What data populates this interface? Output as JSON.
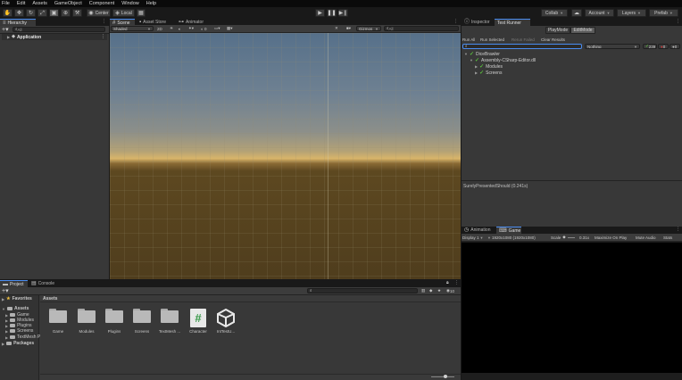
{
  "menu": [
    "File",
    "Edit",
    "Assets",
    "GameObject",
    "Component",
    "Window",
    "Help"
  ],
  "toolbar": {
    "pivot_center": "Center",
    "pivot_local": "Local",
    "collab": "Collab",
    "account": "Account",
    "layers": "Layers",
    "layout": "Prefab"
  },
  "hierarchy": {
    "tab": "Hierarchy",
    "search_placeholder": "All",
    "scene_root": "Application"
  },
  "scene_tabs": [
    "Scene",
    "Asset Store",
    "Animator"
  ],
  "scene_toolbar": {
    "shading": "Shaded",
    "mode": "2D",
    "gizmos": "Gizmos",
    "search_placeholder": "All"
  },
  "inspector": {
    "tabs": [
      "Inspector",
      "Test Runner"
    ],
    "modes": [
      "PlayMode",
      "EditMode"
    ],
    "actions": [
      "Run All",
      "Run Selected",
      "Rerun Failed",
      "Clear Results"
    ],
    "filter_value": "Nothing",
    "counts": {
      "passed": "239",
      "failed": "0",
      "skipped": "0"
    },
    "tree": [
      {
        "label": "DiceBrawler",
        "level": 0
      },
      {
        "label": "Assembly-CSharp-Editor.dll",
        "level": 1
      },
      {
        "label": "Modules",
        "level": 2
      },
      {
        "label": "Screens",
        "level": 2
      }
    ],
    "result_text": "SurelyPresentedShould (0.241s)"
  },
  "game": {
    "tabs": [
      "Animation",
      "Game"
    ],
    "display": "Display 1",
    "resolution": "1920x1080 (1920x1080)",
    "scale_label": "Scale",
    "scale_value": "0.31x",
    "maximize": "Maximize On Play",
    "mute": "Mute Audio",
    "stats": "Stats"
  },
  "project": {
    "tabs": [
      "Project",
      "Console"
    ],
    "favorites": "Favorites",
    "breadcrumb": "Assets",
    "tree": [
      "Assets",
      "Game",
      "Modules",
      "Plugins",
      "Screens",
      "TextMesh P",
      "Packages"
    ],
    "assets": [
      {
        "name": "Game",
        "type": "folder"
      },
      {
        "name": "Modules",
        "type": "folder"
      },
      {
        "name": "Plugins",
        "type": "folder"
      },
      {
        "name": "Screens",
        "type": "folder"
      },
      {
        "name": "TextMesh ...",
        "type": "folder"
      },
      {
        "name": "Character",
        "type": "script"
      },
      {
        "name": "IntTestU...",
        "type": "unity"
      }
    ],
    "badge_count": "10"
  },
  "colors": {
    "accent": "#4a8cf0",
    "pass": "#5bc23c",
    "fail": "#d03a3a"
  }
}
